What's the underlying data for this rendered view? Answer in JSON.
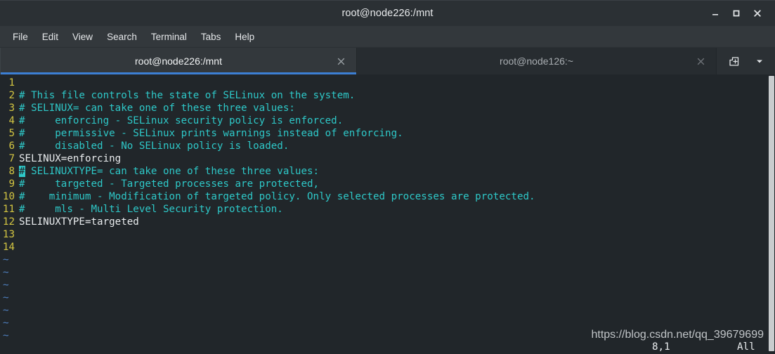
{
  "window": {
    "title": "root@node226:/mnt",
    "controls": [
      {
        "name": "minimize-button",
        "glyph": "minimize"
      },
      {
        "name": "maximize-button",
        "glyph": "maximize"
      },
      {
        "name": "close-button",
        "glyph": "close"
      }
    ]
  },
  "menubar": {
    "items": [
      "File",
      "Edit",
      "View",
      "Search",
      "Terminal",
      "Tabs",
      "Help"
    ]
  },
  "tabs": [
    {
      "label": "root@node226:/mnt",
      "active": true,
      "close_glyph": "×"
    },
    {
      "label": "root@node126:~",
      "active": false,
      "close_glyph": "×"
    }
  ],
  "tabbar_actions": [
    {
      "name": "new-tab-button",
      "icon": "new-tab-icon"
    },
    {
      "name": "tab-list-button",
      "icon": "chevron-down-icon"
    }
  ],
  "editor": {
    "lines": [
      {
        "number": "1",
        "segments": []
      },
      {
        "number": "2",
        "segments": [
          {
            "text": "# This file controls the state of SELinux on the system.",
            "style": "comment"
          }
        ]
      },
      {
        "number": "3",
        "segments": [
          {
            "text": "# SELINUX= can take one of these three values:",
            "style": "comment"
          }
        ]
      },
      {
        "number": "4",
        "segments": [
          {
            "text": "#     enforcing - SELinux security policy is enforced.",
            "style": "comment"
          }
        ]
      },
      {
        "number": "5",
        "segments": [
          {
            "text": "#     permissive - SELinux prints warnings instead of enforcing.",
            "style": "comment"
          }
        ]
      },
      {
        "number": "6",
        "segments": [
          {
            "text": "#     disabled - No SELinux policy is loaded.",
            "style": "comment"
          }
        ]
      },
      {
        "number": "7",
        "segments": [
          {
            "text": "SELINUX=enforcing",
            "style": "code"
          }
        ]
      },
      {
        "number": "8",
        "segments": [
          {
            "text": "#",
            "style": "cursor"
          },
          {
            "text": " SELINUXTYPE= can take one of these three values:",
            "style": "comment"
          }
        ]
      },
      {
        "number": "9",
        "segments": [
          {
            "text": "#     targeted - Targeted processes are protected,",
            "style": "comment"
          }
        ]
      },
      {
        "number": "10",
        "segments": [
          {
            "text": "#    minimum - Modification of targeted policy. Only selected processes are protected.",
            "style": "comment"
          }
        ]
      },
      {
        "number": "11",
        "segments": [
          {
            "text": "#     mls - Multi Level Security protection.",
            "style": "comment"
          }
        ]
      },
      {
        "number": "12",
        "segments": [
          {
            "text": "SELINUXTYPE=targeted",
            "style": "code"
          }
        ]
      },
      {
        "number": "13",
        "segments": []
      },
      {
        "number": "14",
        "segments": []
      }
    ],
    "empty_marker": "~",
    "empty_marker_count": 7
  },
  "statusline": {
    "position": "8,1",
    "scroll": "All"
  },
  "watermark": {
    "text": "https://blog.csdn.net/qq_39679699"
  },
  "colors": {
    "titlebar_bg": "#2b3034",
    "menubar_bg": "#33383c",
    "tab_active_bg": "#33383c",
    "tab_inactive_bg": "#272c30",
    "tab_accent": "#3c7fd4",
    "terminal_bg": "#21262a",
    "comment": "#2ec8c8",
    "code": "#e9ecee",
    "linenumber": "#d4c642",
    "tilde": "#4f7fbf",
    "cursor": "#2ec8c8",
    "scrollbar_thumb": "#c9ccce"
  }
}
